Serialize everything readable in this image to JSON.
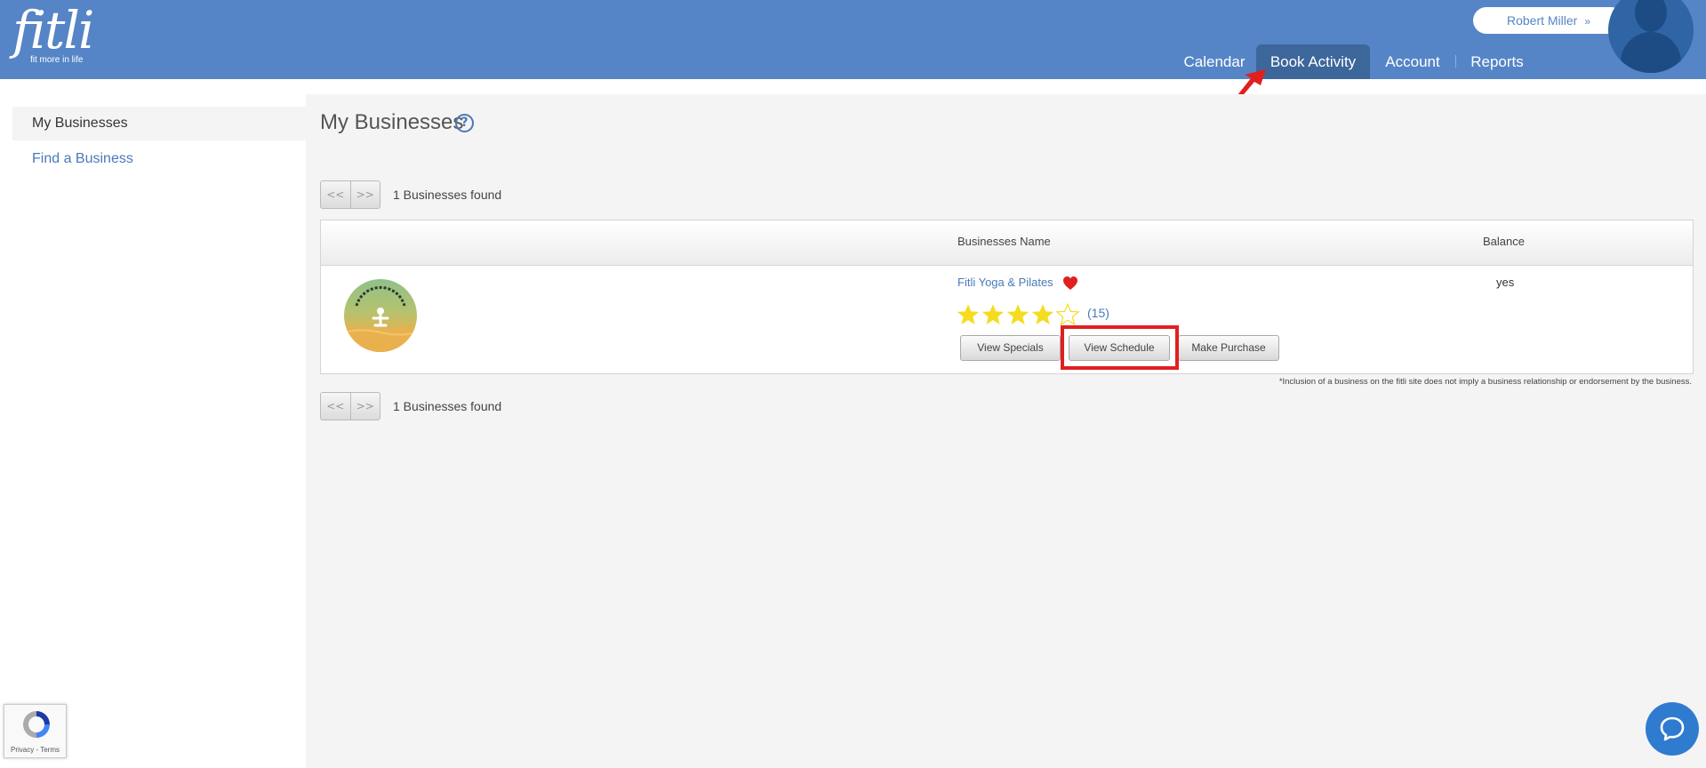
{
  "app": {
    "logo_text": "fitli",
    "logo_tagline": "fit more in life",
    "brand_color": "#5585c6"
  },
  "user": {
    "name": "Robert Miller",
    "menu_icon": "chevron-down-icon"
  },
  "nav": {
    "calendar": "Calendar",
    "book_activity": "Book Activity",
    "account": "Account",
    "reports": "Reports",
    "active": "Book Activity"
  },
  "sidebar": {
    "items": [
      {
        "label": "My Businesses"
      },
      {
        "label": "Find a Business"
      }
    ]
  },
  "main": {
    "title": "My Businesses",
    "help_icon": "?",
    "pager": {
      "prev": "<<",
      "next": ">>"
    },
    "found_text": "1 Businesses found",
    "table": {
      "headers": {
        "name": "Businesses Name",
        "balance": "Balance"
      },
      "rows": [
        {
          "name": "Fitli Yoga & Pilates",
          "favorite": true,
          "balance": "yes",
          "rating": 4,
          "rating_max": 5,
          "reviews": "(15)",
          "buttons": {
            "specials": "View Specials",
            "schedule": "View Schedule",
            "purchase": "Make Purchase"
          }
        }
      ]
    },
    "disclaimer": "*Inclusion of a business on the fitli site does not imply a business relationship or endorsement by the business."
  },
  "recaptcha": {
    "text": "Privacy - Terms"
  },
  "colors": {
    "link": "#4a79b8",
    "highlight": "#e0201f",
    "star": "#f5dc1e",
    "heart": "#e0201f"
  }
}
